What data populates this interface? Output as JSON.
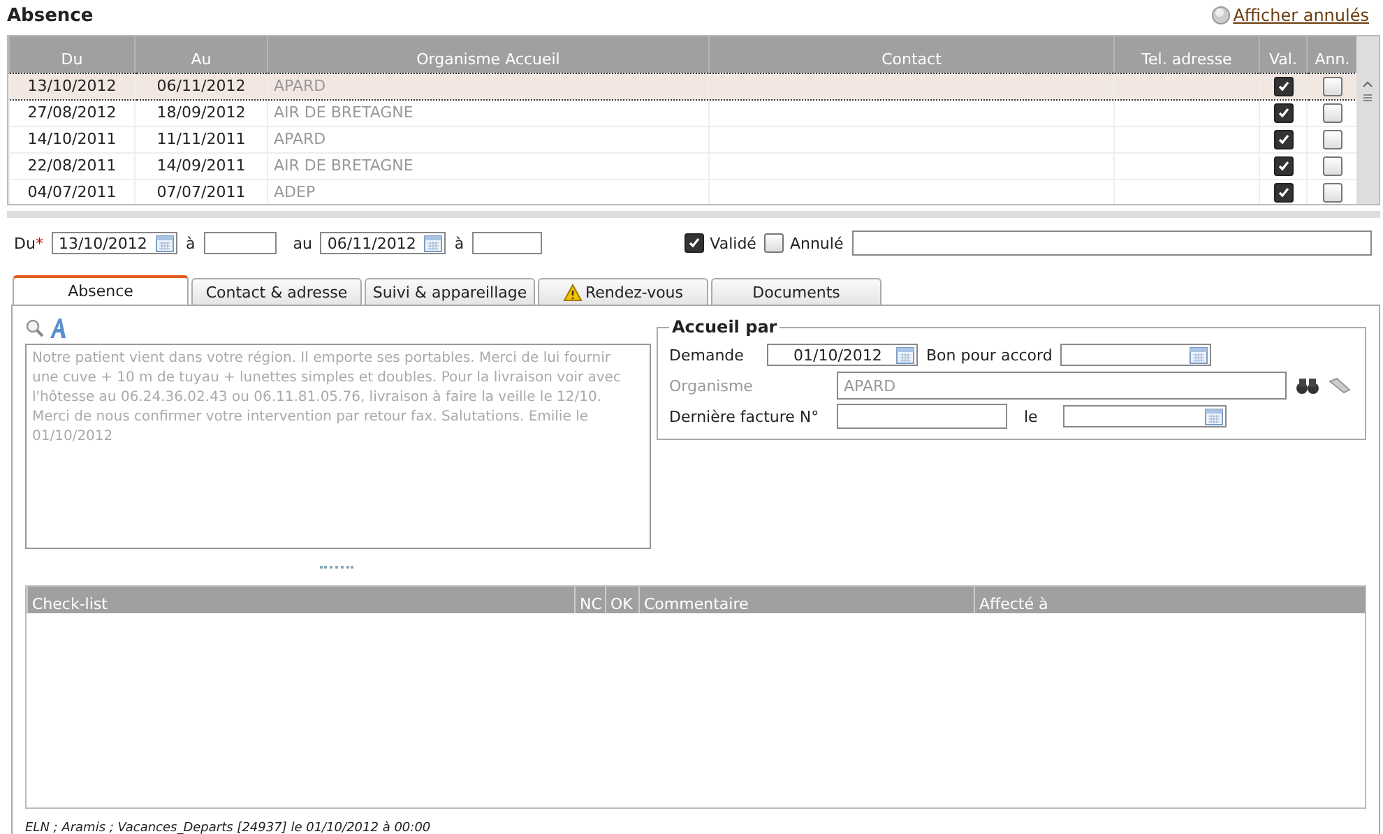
{
  "title": "Absence",
  "show_cancelled_link": "Afficher annulés",
  "table": {
    "columns": [
      "Du",
      "Au",
      "Organisme Accueil",
      "Contact",
      "Tel. adresse",
      "Val.",
      "Ann."
    ],
    "rows": [
      {
        "du": "13/10/2012",
        "au": "06/11/2012",
        "organisme": "APARD",
        "val": true,
        "ann": false,
        "selected": true
      },
      {
        "du": "27/08/2012",
        "au": "18/09/2012",
        "organisme": "AIR DE BRETAGNE",
        "val": true,
        "ann": false,
        "selected": false
      },
      {
        "du": "14/10/2011",
        "au": "11/11/2011",
        "organisme": "APARD",
        "val": true,
        "ann": false,
        "selected": false
      },
      {
        "du": "22/08/2011",
        "au": "14/09/2011",
        "organisme": "AIR DE BRETAGNE",
        "val": true,
        "ann": false,
        "selected": false
      },
      {
        "du": "04/07/2011",
        "au": "07/07/2011",
        "organisme": "ADEP",
        "val": true,
        "ann": false,
        "selected": false
      }
    ]
  },
  "form": {
    "du_label": "Du",
    "required_mark": "*",
    "du_value": "13/10/2012",
    "a_label": "à",
    "au_label": "au",
    "au_value": "06/11/2012",
    "a2_label": "à",
    "valide": {
      "label": "Validé",
      "checked": true
    },
    "annule": {
      "label": "Annulé",
      "checked": false
    }
  },
  "tabs": [
    {
      "label": "Absence",
      "selected": true,
      "warning": false
    },
    {
      "label": "Contact & adresse",
      "selected": false,
      "warning": false
    },
    {
      "label": "Suivi & appareillage",
      "selected": false,
      "warning": false
    },
    {
      "label": "Rendez-vous",
      "selected": false,
      "warning": true
    },
    {
      "label": "Documents",
      "selected": false,
      "warning": false
    }
  ],
  "note": "Notre patient vient dans votre région. Il emporte ses portables. Merci de lui fournir une cuve + 10 m de tuyau + lunettes simples et doubles. Pour la livraison voir avec l'hôtesse  au 06.24.36.02.43 ou 06.11.81.05.76, livraison à faire la veille le 12/10. Merci de nous confirmer votre intervention par retour fax. Salutations. Emilie le 01/10/2012",
  "accueil": {
    "legend": "Accueil par",
    "demande_label": "Demande",
    "demande_value": "01/10/2012",
    "bon_label": "Bon pour accord",
    "organisme_label": "Organisme",
    "organisme_value": "APARD",
    "organisme_disabled": true,
    "facture_label": "Dernière facture N°",
    "le_label": "le"
  },
  "checklist": {
    "columns": [
      "Check-list",
      "NC",
      "OK",
      "Commentaire",
      "Affecté à"
    ]
  },
  "footer": "ELN ; Aramis ; Vacances_Departs [24937] le 01/10/2012 à 00:00"
}
